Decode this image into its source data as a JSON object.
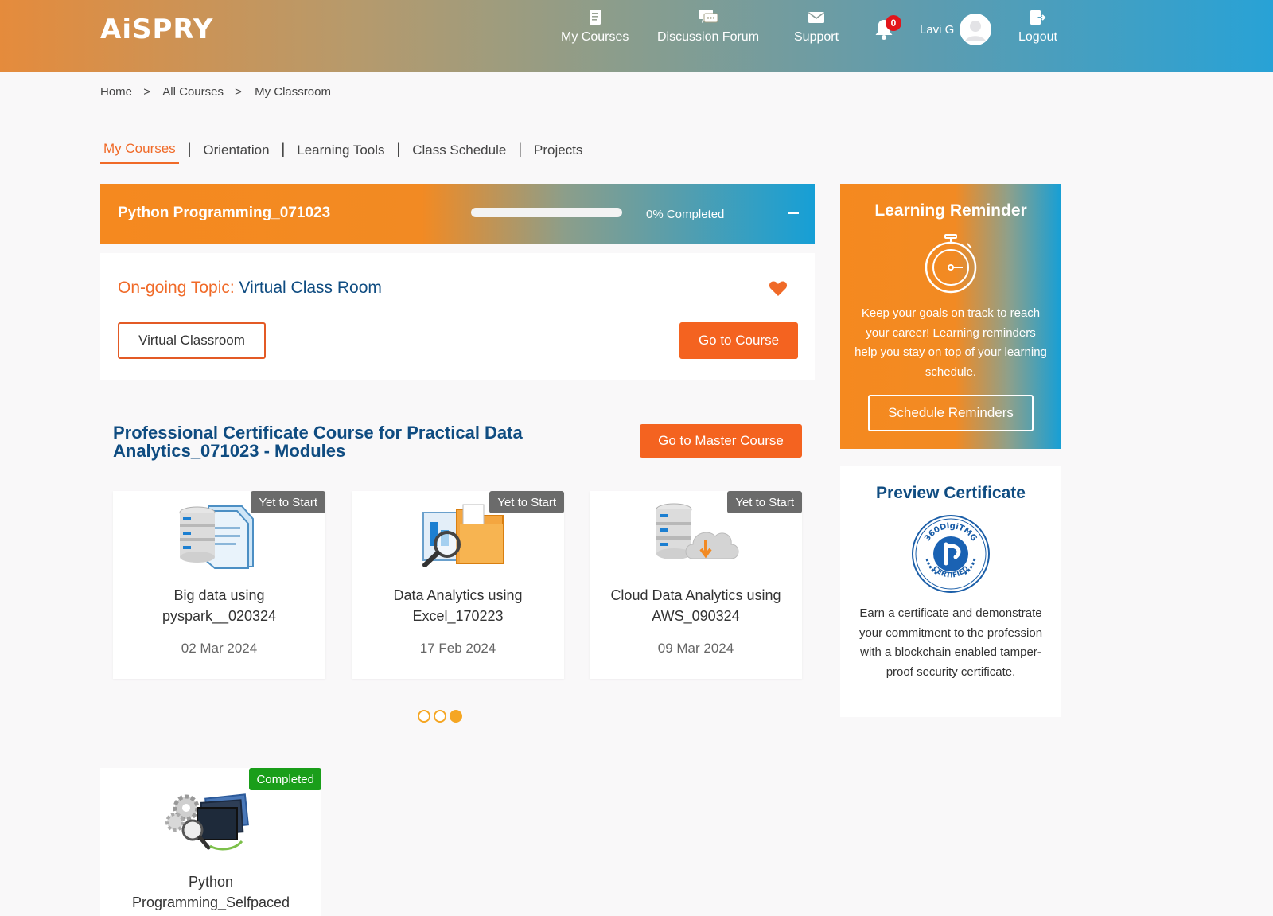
{
  "header": {
    "logo_text": "AiSPRY",
    "nav": [
      {
        "label": "My Courses",
        "icon": "book-icon"
      },
      {
        "label": "Discussion Forum",
        "icon": "chat-bubbles-icon"
      },
      {
        "label": "Support",
        "icon": "envelope-icon"
      }
    ],
    "notifications": {
      "icon": "bell-icon",
      "count": "0"
    },
    "user": {
      "name": "Lavi G",
      "avatar_icon": "user-avatar-icon"
    },
    "logout": {
      "label": "Logout",
      "icon": "logout-icon"
    }
  },
  "breadcrumb": {
    "items": [
      "Home",
      "All Courses",
      "My Classroom"
    ],
    "separator": ">"
  },
  "tabs": {
    "items": [
      "My Courses",
      "Orientation",
      "Learning Tools",
      "Class Schedule",
      "Projects"
    ],
    "active": "My Courses"
  },
  "course": {
    "title": "Python Programming_071023",
    "progress_fraction": 0,
    "progress_text": "0% Completed",
    "topic_label": "On-going Topic:",
    "topic_value": "Virtual Class Room",
    "virtual_classroom_label": "Virtual Classroom",
    "go_to_course_label": "Go to Course"
  },
  "modules": {
    "title": "Professional Certificate Course for Practical Data Analytics_071023 - Modules",
    "go_master_label": "Go to Master Course",
    "items": [
      {
        "status": "Yet to Start",
        "name_line1": "Big data using",
        "name_line2": "pyspark__020324",
        "date": "02 Mar 2024",
        "icon": "database-documents-icon"
      },
      {
        "status": "Yet to Start",
        "name_line1": "Data Analytics using",
        "name_line2": "Excel_170223",
        "date": "17 Feb 2024",
        "icon": "magnifier-folder-icon"
      },
      {
        "status": "Yet to Start",
        "name_line1": "Cloud Data Analytics using",
        "name_line2": "AWS_090324",
        "date": "09 Mar 2024",
        "icon": "database-cloud-icon"
      }
    ],
    "carousel_pages": 3,
    "carousel_active": 3
  },
  "completed_course": {
    "status": "Completed",
    "name_line1": "Python",
    "name_line2": "Programming_Selfpaced",
    "icon": "gears-screens-icon"
  },
  "reminder": {
    "title": "Learning Reminder",
    "text": "Keep your goals on track to reach your career! Learning reminders help you stay on top of your learning schedule.",
    "button_label": "Schedule Reminders",
    "icon": "stopwatch-icon"
  },
  "certificate": {
    "title": "Preview Certificate",
    "seal_top_text": "360DigiTMG",
    "seal_bottom_text": "CERTIFIED",
    "text": "Earn a certificate and demonstrate your commitment to the profession with a blockchain enabled tamper-proof security certificate.",
    "icon": "certified-seal-icon"
  },
  "colors": {
    "accent_orange": "#f46320",
    "brand_blue": "#0f4c81",
    "completed_green": "#1a9e1a",
    "status_gray": "#6b6b6b",
    "notification_red": "#e2151b"
  }
}
